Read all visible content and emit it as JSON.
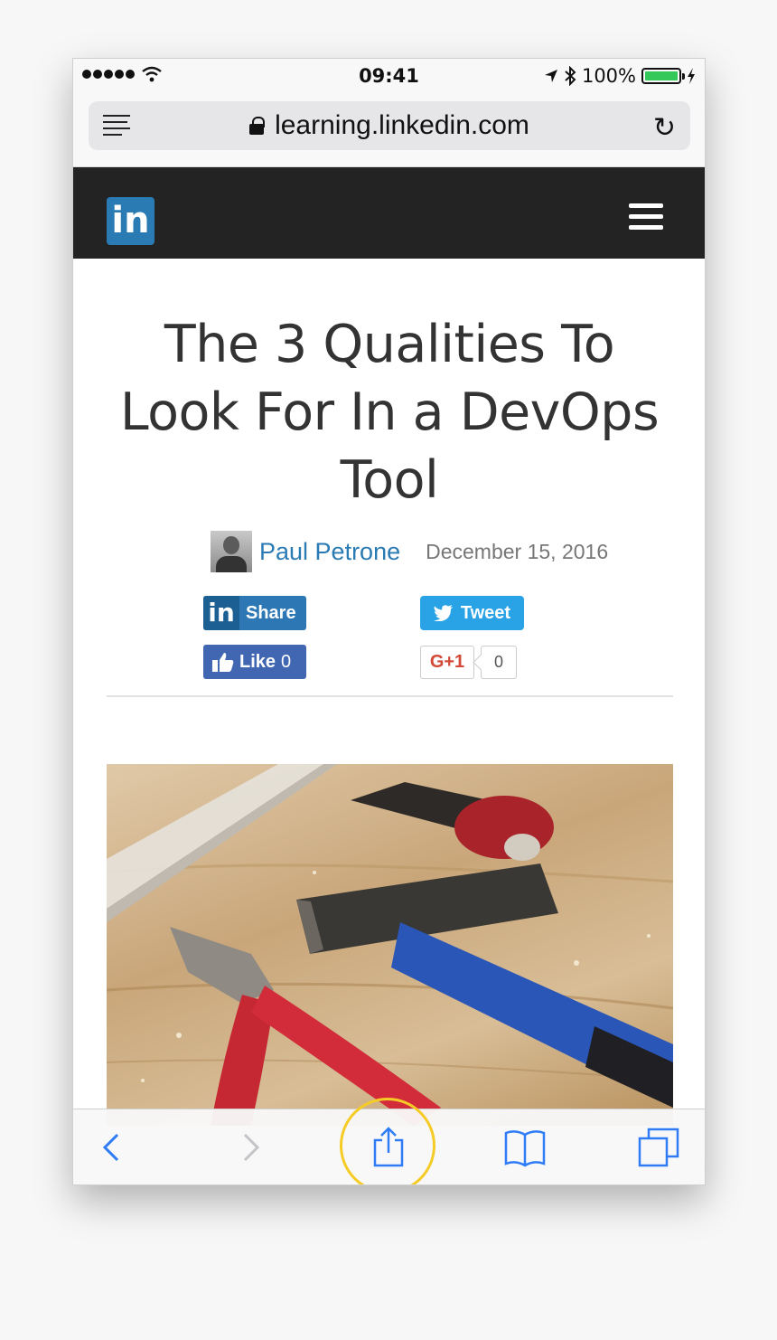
{
  "status_bar": {
    "time": "09:41",
    "battery": "100%",
    "battery_level": 1.0,
    "icons": [
      "signal-dots",
      "wifi-icon",
      "location-arrow-icon",
      "bluetooth-icon",
      "battery-icon",
      "charging-bolt-icon"
    ]
  },
  "browser": {
    "url": "learning.linkedin.com",
    "icons": [
      "reader-icon",
      "lock-icon",
      "reload-icon"
    ]
  },
  "site_header": {
    "logo": "in",
    "icons": [
      "menu-icon"
    ]
  },
  "article": {
    "title": "The 3 Qualities To Look For In a DevOps Tool",
    "author": "Paul Petrone",
    "date": "December 15, 2016"
  },
  "share": {
    "linkedin_logo": "in",
    "linkedin_label": "Share",
    "twitter_label": "Tweet",
    "facebook_label": "Like",
    "facebook_count": "0",
    "gplus_label": "G+1",
    "gplus_count": "0"
  },
  "hero_image": {
    "subject": "tools-on-workbench"
  },
  "toolbar": {
    "icons": [
      "back-icon",
      "forward-icon",
      "share-icon",
      "bookmarks-icon",
      "tabs-icon"
    ],
    "highlighted": "share-icon",
    "accent": "#2f7cf6",
    "highlight_color": "#f5cb26"
  }
}
